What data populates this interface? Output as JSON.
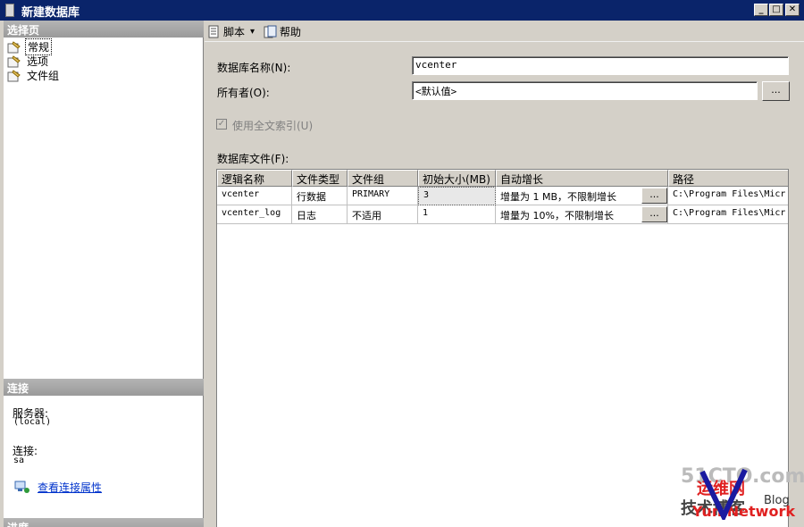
{
  "window": {
    "title": "新建数据库",
    "min_symbol": "_",
    "max_symbol": "□",
    "close_symbol": "✕"
  },
  "left": {
    "select_page_header": "选择页",
    "pages": [
      {
        "label": "常规",
        "selected": true
      },
      {
        "label": "选项",
        "selected": false
      },
      {
        "label": "文件组",
        "selected": false
      }
    ],
    "connection_header": "连接",
    "server_label": "服务器:",
    "server_value": "(local)",
    "connection_label": "连接:",
    "connection_value": "sa",
    "view_properties_link": "查看连接属性",
    "progress_header": "进度"
  },
  "toolbar": {
    "script_label": "脚本",
    "script_dropdown_icon": "▾",
    "help_label": "帮助"
  },
  "form": {
    "db_name_label": "数据库名称(N):",
    "db_name_value": "vcenter",
    "owner_label": "所有者(O):",
    "owner_value": "<默认值>",
    "owner_browse": "...",
    "fulltext_label": "使用全文索引(U)",
    "fulltext_checked": "✓",
    "files_label": "数据库文件(F):"
  },
  "table": {
    "headers": [
      "逻辑名称",
      "文件类型",
      "文件组",
      "初始大小(MB)",
      "自动增长",
      "路径"
    ],
    "rows": [
      {
        "logical": "vcenter",
        "type": "行数据",
        "group": "PRIMARY",
        "size": "3",
        "growth": "增量为 1 MB，不限制增长",
        "btn": "...",
        "path": "C:\\Program Files\\Micr"
      },
      {
        "logical": "vcenter_log",
        "type": "日志",
        "group": "不适用",
        "size": "1",
        "growth": "增量为 10%，不限制增长",
        "btn": "...",
        "path": "C:\\Program Files\\Micr"
      }
    ]
  },
  "watermark": {
    "line1": "51CTO.com",
    "line2": "技术博客",
    "line3": "Blog",
    "line4": "运维网",
    "line5": "Yun Network"
  }
}
